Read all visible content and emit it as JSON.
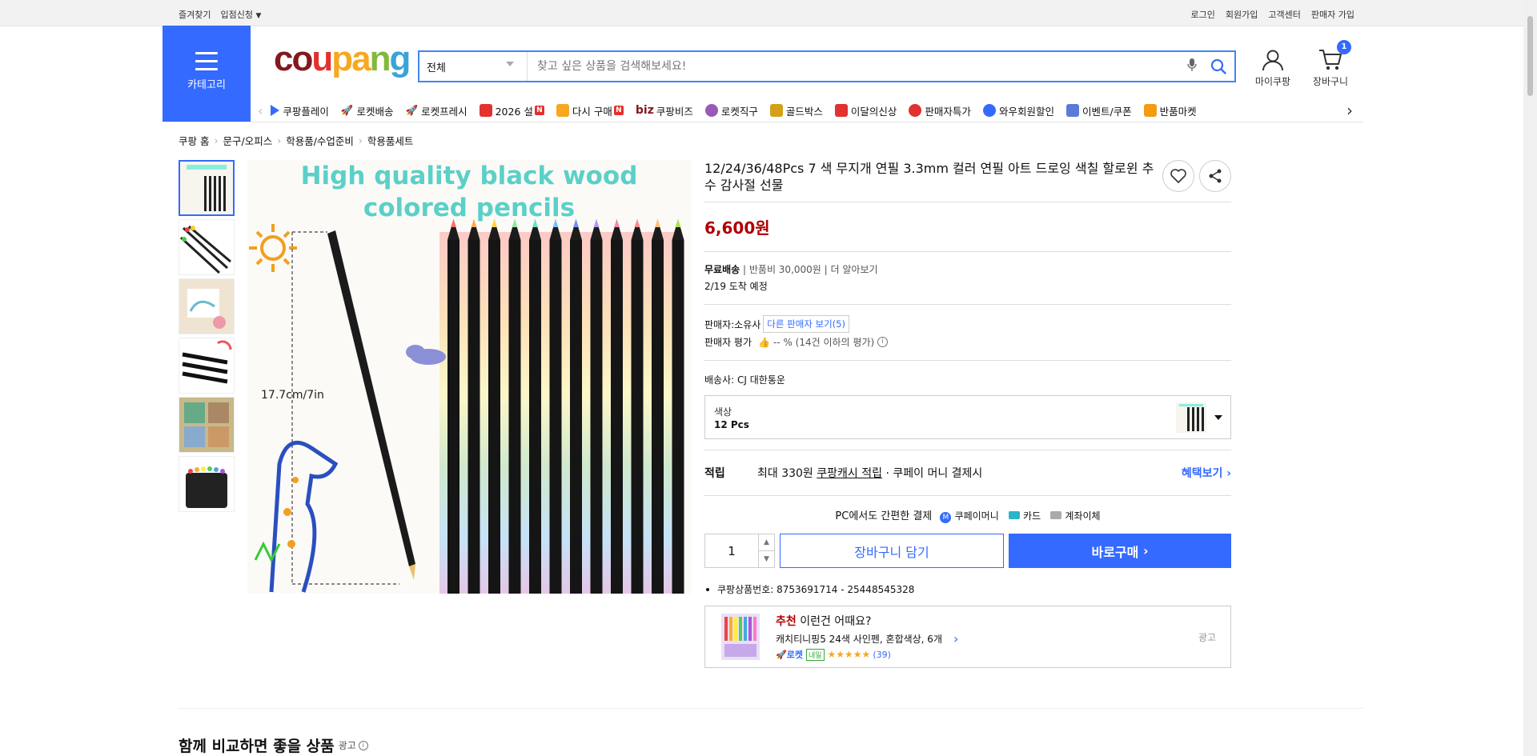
{
  "topbar": {
    "left": [
      "즐겨찾기",
      "입점신청"
    ],
    "right": [
      "로그인",
      "회원가입",
      "고객센터",
      "판매자 가입"
    ]
  },
  "header": {
    "category_label": "카테고리",
    "logo": {
      "c1": "co",
      "c2": "u",
      "c3": "pa",
      "c4": "n",
      "c5": "g"
    },
    "search_scope": "전체",
    "search_placeholder": "찾고 싶은 상품을 검색해보세요!",
    "mypage_label": "마이쿠팡",
    "cart_label": "장바구니",
    "cart_count": "1"
  },
  "nav": [
    {
      "label": "쿠팡플레이",
      "icon": "play-icon",
      "color": "#346aff"
    },
    {
      "label": "로켓배송",
      "icon": "rocket-icon",
      "color": "#3aa3d7"
    },
    {
      "label": "로켓프레시",
      "icon": "rocket-fresh-icon",
      "color": "#84b83c"
    },
    {
      "label": "2026 설",
      "icon": "gift-icon",
      "color": "#e2312e",
      "badge": "N"
    },
    {
      "label": "다시 구매",
      "icon": "home-icon",
      "color": "#f7a81e",
      "badge": "N"
    },
    {
      "label": "쿠팡비즈",
      "icon": "biz-icon",
      "color": "#83191d",
      "prefix": "biz"
    },
    {
      "label": "로켓직구",
      "icon": "global-rocket-icon",
      "color": "#9b59b6"
    },
    {
      "label": "골드박스",
      "icon": "goldbox-icon",
      "color": "#d4a017"
    },
    {
      "label": "이달의신상",
      "icon": "new-icon",
      "color": "#e2312e"
    },
    {
      "label": "판매자특가",
      "icon": "percent-icon",
      "color": "#e2312e"
    },
    {
      "label": "와우회원할인",
      "icon": "wow-icon",
      "color": "#346aff"
    },
    {
      "label": "이벤트/쿠폰",
      "icon": "coupon-icon",
      "color": "#5a7bd8"
    },
    {
      "label": "반품마켓",
      "icon": "market-icon",
      "color": "#f39c12"
    }
  ],
  "breadcrumb": [
    "쿠팡 홈",
    "문구/오피스",
    "학용품/수업준비",
    "학용품세트"
  ],
  "product": {
    "image_text_1": "High quality black wood",
    "image_text_2": "colored pencils",
    "image_measure": "17.7cm/7in",
    "title": "12/24/36/48Pcs 7 색 무지개 연필 3.3mm 컬러 연필 아트 드로잉 색칠 할로윈 추수 감사절 선물",
    "price": "6,600원",
    "shipping_free": "무료배송",
    "return_fee": "반품비 30,000원",
    "more": "더 알아보기",
    "arrival": "2/19 도착 예정",
    "seller_label": "판매자:",
    "seller_name": "소유사",
    "other_sellers": "다른 판매자 보기(5)",
    "seller_rating_label": "판매자 평가",
    "seller_rating_value": "-- % (14건 이하의 평가)",
    "carrier_label": "배송사:",
    "carrier": "CJ 대한통운",
    "option_label": "색상",
    "option_value": "12 Pcs",
    "reward_label": "적립",
    "reward_prefix": "최대 330원",
    "reward_link": "쿠팡캐시 적립",
    "reward_suffix": "· 쿠페이 머니 결제시",
    "benefit_link": "혜택보기",
    "pay_text": "PC에서도 간편한 결제",
    "pay_money": "쿠페이머니",
    "pay_card": "카드",
    "pay_bank": "계좌이체",
    "quantity": "1",
    "add_to_cart": "장바구니 담기",
    "buy_now": "바로구매",
    "product_no": "쿠팡상품번호: 8753691714 - 25448545328"
  },
  "recommend": {
    "tag": "추천",
    "title": "이런건 어때요?",
    "item": "캐치티니핑5 24색 사인펜, 혼합색상, 6개",
    "rocket": "로켓",
    "rocket_tag": "내일",
    "reviews": "(39)",
    "rating": 5,
    "ad": "광고"
  },
  "section": {
    "title": "함께 비교하면 좋을 상품",
    "ad": "광고"
  },
  "colors": {
    "accent": "#346aff",
    "price": "#ae0000"
  }
}
